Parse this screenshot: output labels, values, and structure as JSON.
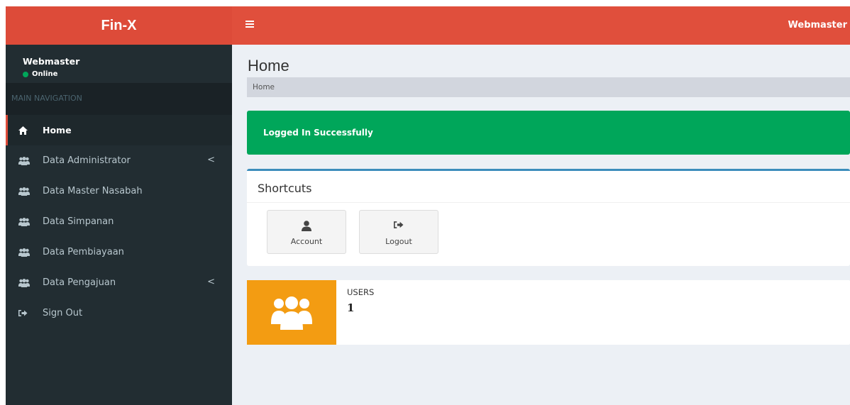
{
  "app": {
    "brand": "Fin-X"
  },
  "header": {
    "user": "Webmaster"
  },
  "sidebar": {
    "user_name": "Webmaster",
    "status": "Online",
    "nav_header": "MAIN NAVIGATION",
    "items": [
      {
        "label": "Home",
        "icon": "home-icon",
        "active": true
      },
      {
        "label": "Data Administrator",
        "icon": "users-icon",
        "caret": "<"
      },
      {
        "label": "Data Master Nasabah",
        "icon": "users-icon"
      },
      {
        "label": "Data Simpanan",
        "icon": "users-icon"
      },
      {
        "label": "Data Pembiayaan",
        "icon": "users-icon"
      },
      {
        "label": "Data Pengajuan",
        "icon": "users-icon",
        "caret": "<"
      },
      {
        "label": "Sign Out",
        "icon": "sign-out-icon"
      }
    ]
  },
  "main": {
    "title": "Home",
    "breadcrumb": "Home",
    "alert": "Logged In Successfully",
    "shortcuts": {
      "title": "Shortcuts",
      "items": [
        {
          "label": "Account",
          "icon": "user-icon"
        },
        {
          "label": "Logout",
          "icon": "sign-out-icon"
        }
      ]
    },
    "info": {
      "label": "USERS",
      "value": "1"
    }
  },
  "colors": {
    "brand": "#dd4b39",
    "sidebar": "#222d32",
    "success": "#00a65a",
    "warning": "#f39c12",
    "primary": "#3c8dbc"
  }
}
